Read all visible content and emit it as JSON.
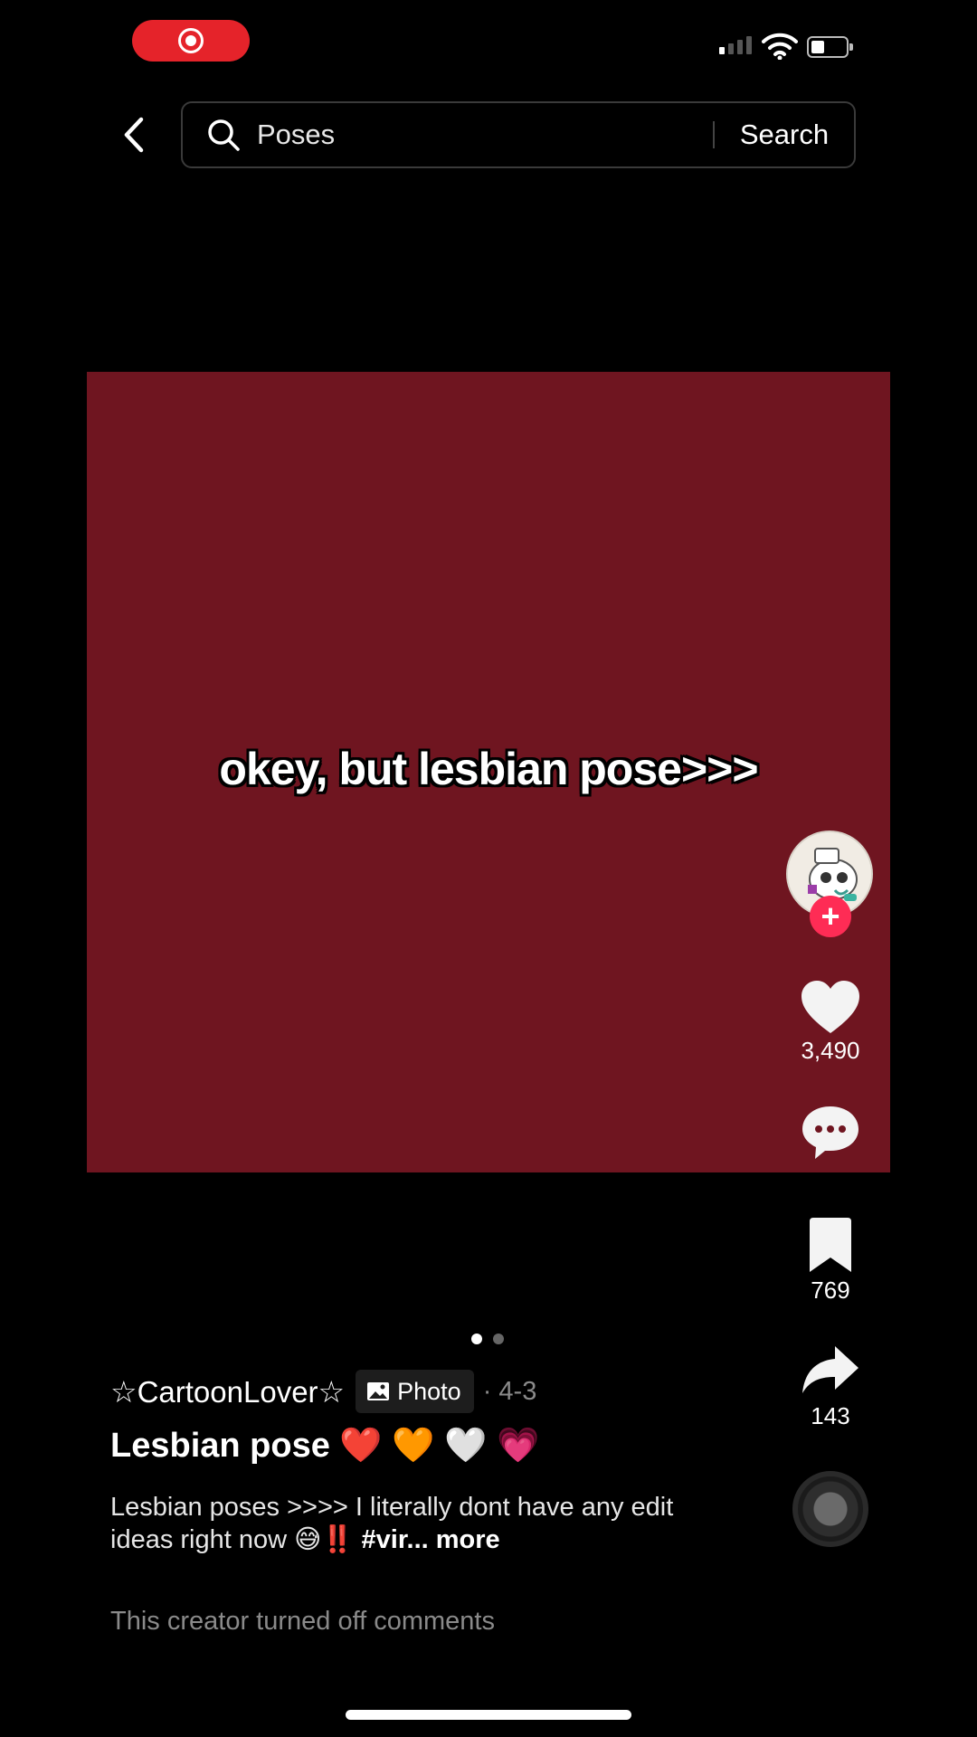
{
  "status_bar": {
    "recording_color": "#e5232a"
  },
  "header": {
    "search_query": "Poses",
    "search_button": "Search"
  },
  "media": {
    "background_color": "#6f1520",
    "overlay_text": "okey, but lesbian pose>>>",
    "slide_count": 2,
    "active_slide": 1
  },
  "rail": {
    "likes": "3,490",
    "bookmarks": "769",
    "shares": "143",
    "follow_symbol": "+"
  },
  "post": {
    "username": "☆CartoonLover☆",
    "type_label": "Photo",
    "date": "· 4-3",
    "title": "Lesbian pose ❤️ 🧡 🤍 💗",
    "description": "Lesbian poses >>>> I literally dont have any edit ideas right now 😅‼️ ",
    "hashtag": "#vir...",
    "more_label": " more",
    "comments_notice": "This creator turned off comments"
  }
}
